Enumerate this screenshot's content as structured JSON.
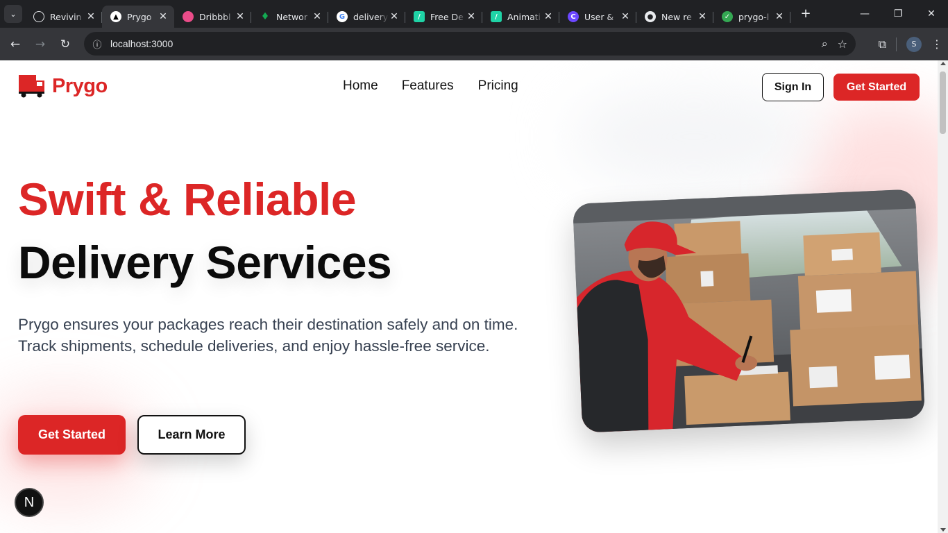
{
  "browser": {
    "tabs": [
      {
        "title": "Revivin",
        "icon": "openai-icon",
        "color": "#e8eaed"
      },
      {
        "title": "Prygo",
        "icon": "nextjs-icon",
        "color": "#ffffff",
        "active": true
      },
      {
        "title": "Dribbbl",
        "icon": "dribbble-icon",
        "color": "#ea4c89"
      },
      {
        "title": "Networ",
        "icon": "mongodb-icon",
        "color": "#13aa52"
      },
      {
        "title": "delivery",
        "icon": "google-icon",
        "color": "#4285f4"
      },
      {
        "title": "Free De",
        "icon": "framer-icon",
        "color": "#1fd3a6"
      },
      {
        "title": "Animati",
        "icon": "framer-icon",
        "color": "#1fd3a6"
      },
      {
        "title": "User &",
        "icon": "clerk-icon",
        "color": "#6c47ff"
      },
      {
        "title": "New re",
        "icon": "github-icon",
        "color": "#e8eaed"
      },
      {
        "title": "prygo-l",
        "icon": "vercel-icon",
        "color": "#34a853"
      }
    ],
    "url": "localhost:3000",
    "profile_initial": "S"
  },
  "header": {
    "brand": "Prygo",
    "nav": [
      "Home",
      "Features",
      "Pricing"
    ],
    "sign_in": "Sign In",
    "get_started": "Get Started"
  },
  "hero": {
    "title_line1": "Swift & Reliable",
    "title_line2": "Delivery Services",
    "description": "Prygo ensures your packages reach their destination safely and on time. Track shipments, schedule deliveries, and enjoy hassle-free service.",
    "primary_cta": "Get Started",
    "secondary_cta": "Learn More"
  },
  "dev_badge": "N",
  "colors": {
    "brand": "#dc2626",
    "text": "#111111"
  }
}
